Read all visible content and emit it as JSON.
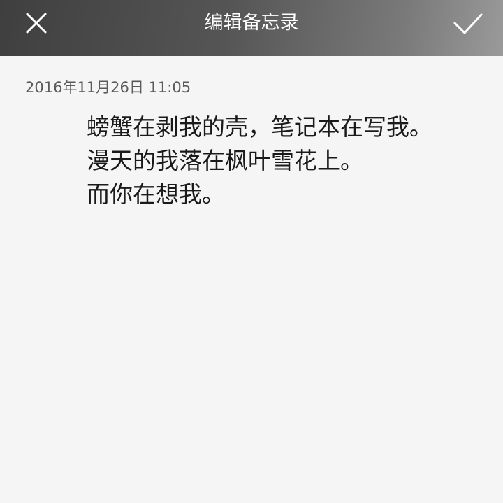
{
  "header": {
    "title": "编辑备忘录",
    "close_icon": "close-icon",
    "confirm_icon": "checkmark-icon"
  },
  "note": {
    "timestamp": "2016年11月26日 11:05",
    "lines": [
      "螃蟹在剥我的壳，笔记本在写我。",
      "漫天的我落在枫叶雪花上。",
      "而你在想我。"
    ]
  },
  "colors": {
    "header_start": "#3f3f3f",
    "header_end": "#9a9a9a",
    "background": "#f5f5f5",
    "text": "#1a1a1a",
    "timestamp": "#5a5a5a"
  }
}
